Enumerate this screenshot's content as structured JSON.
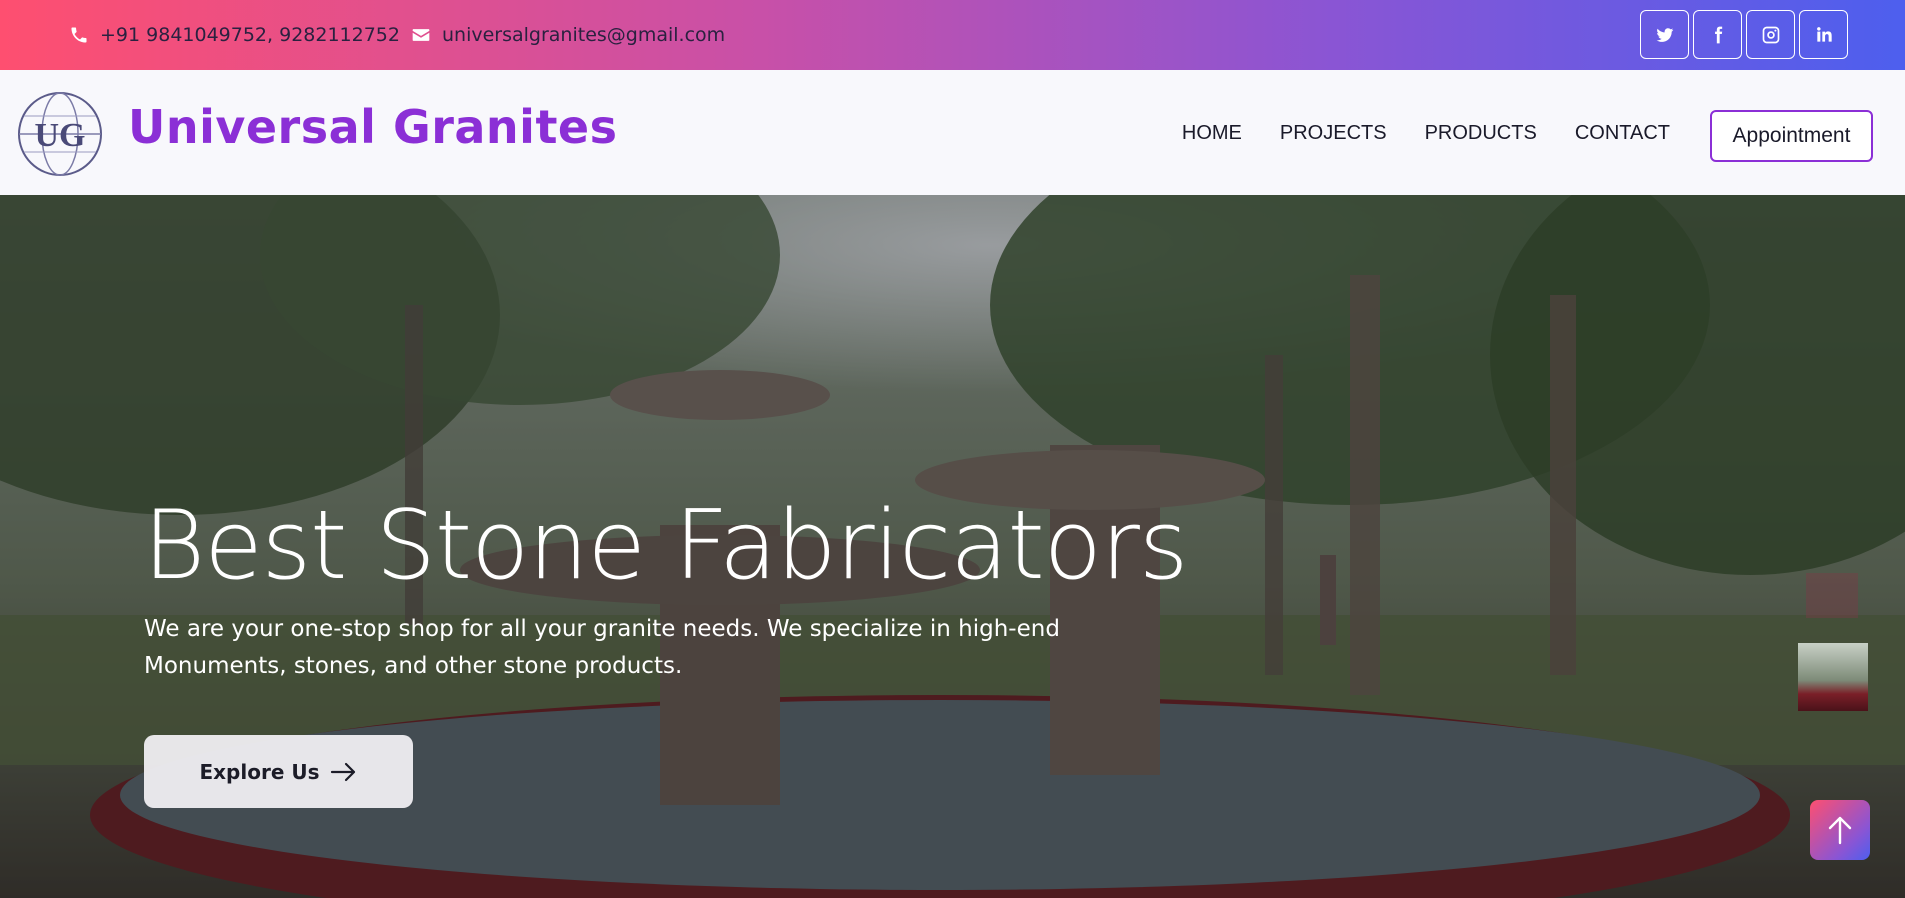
{
  "topbar": {
    "phone": "+91 9841049752,  9282112752",
    "email": "universalgranites@gmail.com",
    "social_icons": [
      "twitter-icon",
      "facebook-icon",
      "instagram-icon",
      "linkedin-icon"
    ],
    "gradient_colors": [
      "#fe4f70",
      "#c850a8",
      "#8a55d4",
      "#4d5fee"
    ]
  },
  "header": {
    "brand": "Universal Granites",
    "logo_letters": "UG",
    "brand_color": "#8b2fd6",
    "nav": [
      "HOME",
      "PROJECTS",
      "PRODUCTS",
      "CONTACT"
    ],
    "appointment_label": "Appointment"
  },
  "hero": {
    "title": "Best Stone Fabricators",
    "subtitle": "We are your one-stop shop for all your granite needs. We specialize in high-end Monuments, stones, and other stone products.",
    "cta_label": "Explore Us"
  }
}
